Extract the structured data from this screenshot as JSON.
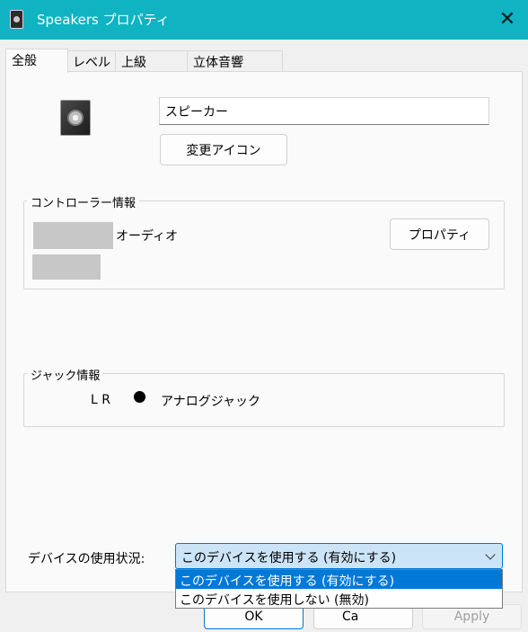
{
  "window": {
    "title": "Speakers プロパティ",
    "close_glyph": "✕"
  },
  "tabs": [
    {
      "label": "全般"
    },
    {
      "label": "レベル"
    },
    {
      "label": "上級"
    },
    {
      "label": "立体音響"
    }
  ],
  "general": {
    "device_name_value": "スピーカー",
    "change_icon_label": "変更アイコン",
    "controller_info": {
      "legend": "コントローラー情報",
      "controller_name_suffix": "オーディオ",
      "properties_label": "プロパティ"
    },
    "jack_info": {
      "legend": "ジャック情報",
      "channels": "L R",
      "jack_label": "アナログジャック"
    },
    "device_usage": {
      "label": "デバイスの使用状況:",
      "selected": "このデバイスを使用する (有効にする)",
      "options": [
        "このデバイスを使用する (有効にする)",
        "このデバイスを使用しない (無効)"
      ]
    }
  },
  "footer": {
    "ok_label": "OK",
    "cancel_label": "Ca",
    "apply_label": "Apply"
  },
  "colors": {
    "titlebar": "#0fb3c1",
    "selection": "#0078d7",
    "select_background": "#cce4f7"
  }
}
